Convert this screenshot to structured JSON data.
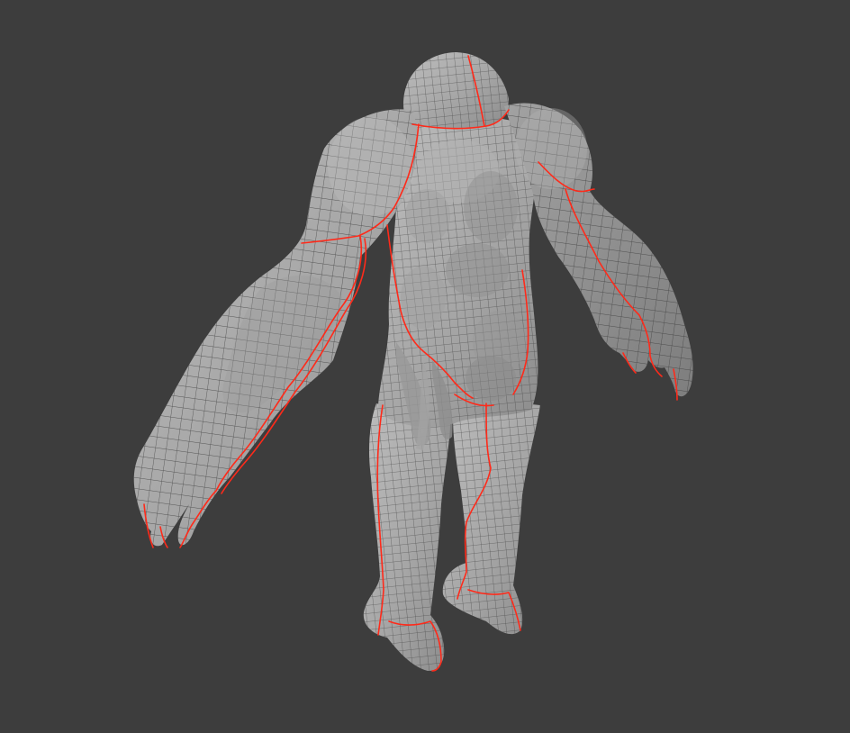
{
  "viewport": {
    "background_color": "#3d3d3d",
    "mesh_fill_color": "#a9a9a9",
    "mesh_shadow_color": "#8a8a8a",
    "wire_color": "#3a3a3a",
    "seam_color": "#ff2a1a",
    "object": "creature-mesh-wireframe-with-uv-seams"
  }
}
